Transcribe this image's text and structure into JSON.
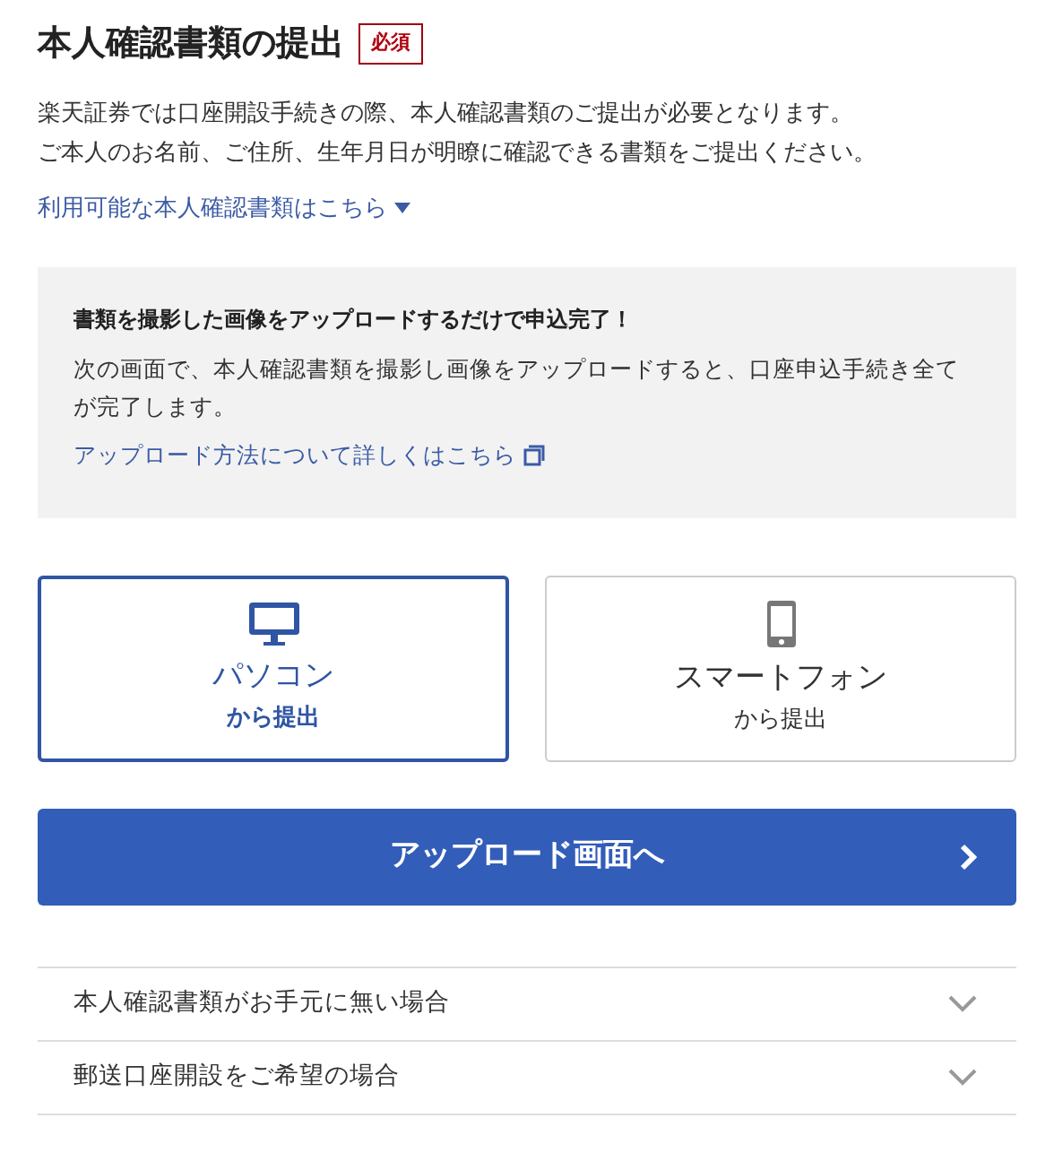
{
  "title": "本人確認書類の提出",
  "required_badge": "必須",
  "intro": [
    "楽天証券では口座開設手続きの際、本人確認書類のご提出が必要となります。",
    "ご本人のお名前、ご住所、生年月日が明瞭に確認できる書類をご提出ください。"
  ],
  "documents_link": "利用可能な本人確認書類はこちら",
  "info_box": {
    "heading": "書類を撮影した画像をアップロードするだけで申込完了！",
    "body": "次の画面で、本人確認書類を撮影し画像をアップロードすると、口座申込手続き全てが完了します。",
    "link": "アップロード方法について詳しくはこちら"
  },
  "methods": [
    {
      "kind": "pc",
      "label": "パソコン",
      "sublabel": "から提出",
      "selected": true
    },
    {
      "kind": "phone",
      "label": "スマートフォン",
      "sublabel": "から提出",
      "selected": false
    }
  ],
  "submit_button": "アップロード画面へ",
  "accordion": [
    {
      "label": "本人確認書類がお手元に無い場合",
      "expanded": false
    },
    {
      "label": "郵送口座開設をご希望の場合",
      "expanded": false
    }
  ]
}
